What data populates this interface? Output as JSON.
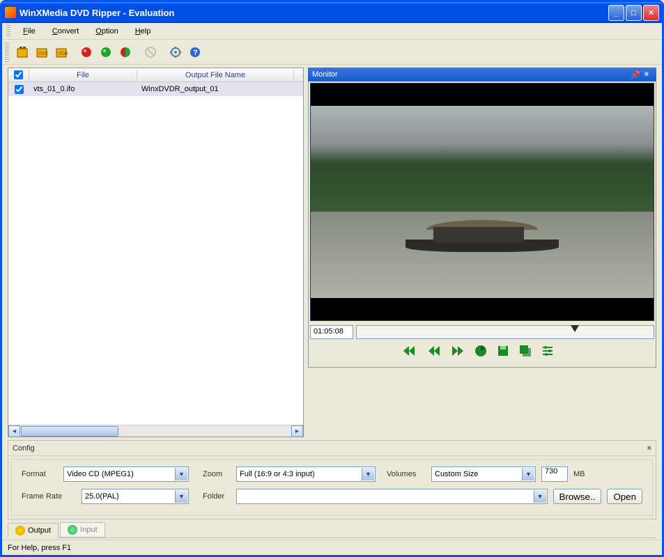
{
  "titlebar": {
    "title": "WinXMedia DVD Ripper - Evaluation"
  },
  "menu": {
    "file": "File",
    "convert": "Convert",
    "option": "Option",
    "help": "Help"
  },
  "filelist": {
    "headers": {
      "file": "File",
      "output": "Output File Name"
    },
    "rows": [
      {
        "checked": true,
        "file": "vts_01_0.ifo",
        "output": "WinxDVDR_output_01"
      }
    ]
  },
  "monitor": {
    "title": "Monitor",
    "timecode": "01:05:08"
  },
  "config": {
    "title": "Config",
    "format_label": "Format",
    "format_value": "Video CD (MPEG1)",
    "zoom_label": "Zoom",
    "zoom_value": "Full (16:9 or 4:3 input)",
    "volumes_label": "Volumes",
    "volumes_value": "Custom Size",
    "volumes_size": "730",
    "volumes_unit": "MB",
    "framerate_label": "Frame Rate",
    "framerate_value": "25.0(PAL)",
    "folder_label": "Folder",
    "folder_value": "",
    "browse_btn": "Browse..",
    "open_btn": "Open"
  },
  "tabs": {
    "output": "Output",
    "input": "Input"
  },
  "statusbar": {
    "text": "For Help, press F1"
  }
}
